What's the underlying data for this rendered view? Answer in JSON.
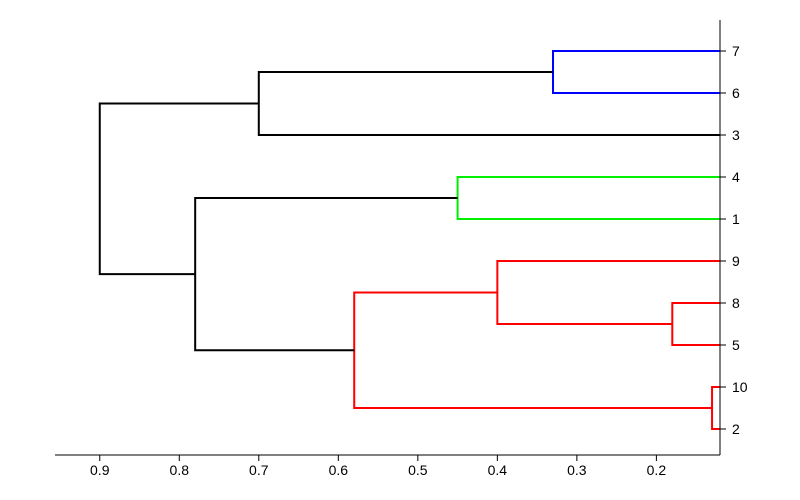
{
  "chart_data": {
    "type": "dendrogram",
    "orientation": "right",
    "x_axis": {
      "reversed": true,
      "ticks": [
        0.9,
        0.8,
        0.7,
        0.6,
        0.5,
        0.4,
        0.3,
        0.2
      ],
      "range": [
        0.95,
        0.12
      ]
    },
    "leaves_order": [
      "7",
      "6",
      "3",
      "4",
      "1",
      "9",
      "8",
      "5",
      "10",
      "2"
    ],
    "links": [
      {
        "height": 0.13,
        "children_heights": [
          0.0,
          0.0
        ],
        "children_y": [
          9,
          10
        ],
        "color": "red"
      },
      {
        "height": 0.18,
        "children_heights": [
          0.0,
          0.0
        ],
        "children_y": [
          7,
          8
        ],
        "color": "red"
      },
      {
        "height": 0.4,
        "children_heights": [
          0.0,
          0.18
        ],
        "children_y": [
          6,
          7.5
        ],
        "color": "red"
      },
      {
        "height": 0.58,
        "children_heights": [
          0.4,
          0.13
        ],
        "children_y": [
          6.75,
          9.5
        ],
        "color": "red"
      },
      {
        "height": 0.33,
        "children_heights": [
          0.0,
          0.0
        ],
        "children_y": [
          1,
          2
        ],
        "color": "blue"
      },
      {
        "height": 0.45,
        "children_heights": [
          0.0,
          0.0
        ],
        "children_y": [
          4,
          5
        ],
        "color": "green"
      },
      {
        "height": 0.7,
        "children_heights": [
          0.33,
          0.0
        ],
        "children_y": [
          1.5,
          3
        ],
        "color": "black"
      },
      {
        "height": 0.78,
        "children_heights": [
          0.45,
          0.58
        ],
        "children_y": [
          4.5,
          8.125
        ],
        "color": "black"
      },
      {
        "height": 0.9,
        "children_heights": [
          0.7,
          0.78
        ],
        "children_y": [
          2.25,
          6.3125
        ],
        "color": "black"
      }
    ],
    "colors": {
      "red": "#ff0000",
      "blue": "#0000ff",
      "green": "#00f000",
      "black": "#000000"
    }
  }
}
